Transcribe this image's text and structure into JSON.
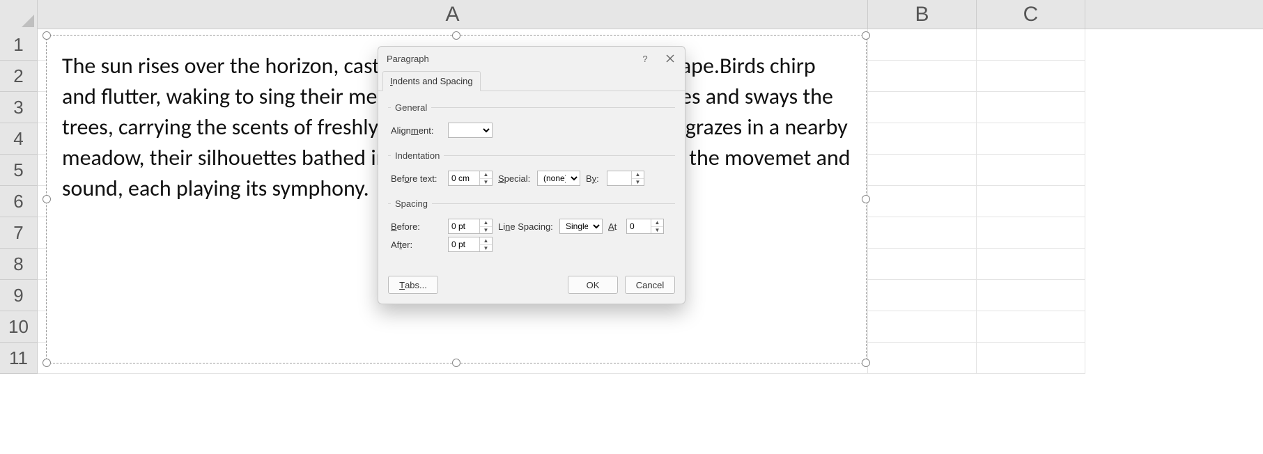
{
  "columns": [
    "A",
    "B",
    "C"
  ],
  "rows": [
    "1",
    "2",
    "3",
    "4",
    "5",
    "6",
    "7",
    "8",
    "9",
    "10",
    "11"
  ],
  "textbox": {
    "text": "The sun rises over the horizon, casting a golden glow over the landscape.Birds chirp and flutter, waking to sing their melodious songs.The cool breez rustles and sways the trees, carrying the scents of freshly bloomed flowers. A herd of cows grazes in a nearby meadow, their silhouettes bathed in soft light. The world is alive with the movemet and sound, each playing its symphony."
  },
  "dialog": {
    "title": "Paragraph",
    "help": "?",
    "tab": {
      "pre": "",
      "accel": "I",
      "post": "ndents and Spacing"
    },
    "general": {
      "legend": "General",
      "alignment_label": {
        "pre": "Align",
        "accel": "m",
        "post": "ent:"
      },
      "alignment_value": ""
    },
    "indent": {
      "legend": "Indentation",
      "before_label": {
        "pre": "Bef",
        "accel": "o",
        "post": "re text:"
      },
      "before_value": "0 cm",
      "special_label": {
        "pre": "",
        "accel": "S",
        "post": "pecial:"
      },
      "special_value": "(none)",
      "by_label": {
        "pre": "B",
        "accel": "y",
        "post": ":"
      },
      "by_value": ""
    },
    "spacing": {
      "legend": "Spacing",
      "before_label": {
        "pre": "",
        "accel": "B",
        "post": "efore:"
      },
      "before_value": "0 pt",
      "after_label": {
        "pre": "Af",
        "accel": "t",
        "post": "er:"
      },
      "after_value": "0 pt",
      "ls_label": {
        "pre": "Li",
        "accel": "n",
        "post": "e Spacing:"
      },
      "ls_value": "Single",
      "at_label": {
        "pre": "",
        "accel": "A",
        "post": "t"
      },
      "at_value": "0"
    },
    "buttons": {
      "tabs": {
        "pre": "",
        "accel": "T",
        "post": "abs..."
      },
      "ok": "OK",
      "cancel": "Cancel"
    }
  }
}
